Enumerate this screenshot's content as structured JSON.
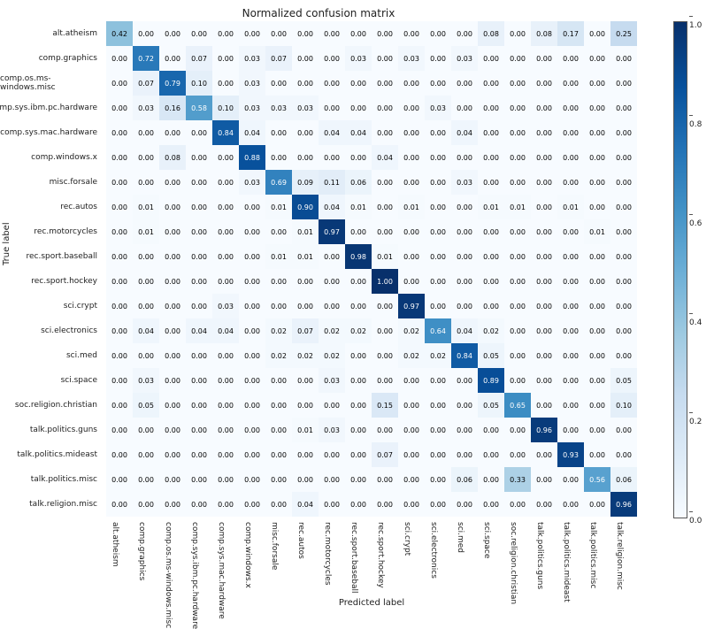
{
  "chart_data": {
    "type": "heatmap",
    "title": "Normalized confusion matrix",
    "xlabel": "Predicted label",
    "ylabel": "True label",
    "categories": [
      "alt.atheism",
      "comp.graphics",
      "comp.os.ms-windows.misc",
      "comp.sys.ibm.pc.hardware",
      "comp.sys.mac.hardware",
      "comp.windows.x",
      "misc.forsale",
      "rec.autos",
      "rec.motorcycles",
      "rec.sport.baseball",
      "rec.sport.hockey",
      "sci.crypt",
      "sci.electronics",
      "sci.med",
      "sci.space",
      "soc.religion.christian",
      "talk.politics.guns",
      "talk.politics.mideast",
      "talk.politics.misc",
      "talk.religion.misc"
    ],
    "values": [
      [
        0.42,
        0.0,
        0.0,
        0.0,
        0.0,
        0.0,
        0.0,
        0.0,
        0.0,
        0.0,
        0.0,
        0.0,
        0.0,
        0.0,
        0.08,
        0.0,
        0.08,
        0.17,
        0.0,
        0.25
      ],
      [
        0.0,
        0.72,
        0.0,
        0.07,
        0.0,
        0.03,
        0.07,
        0.0,
        0.0,
        0.03,
        0.0,
        0.03,
        0.0,
        0.03,
        0.0,
        0.0,
        0.0,
        0.0,
        0.0,
        0.0
      ],
      [
        0.0,
        0.07,
        0.79,
        0.1,
        0.0,
        0.03,
        0.0,
        0.0,
        0.0,
        0.0,
        0.0,
        0.0,
        0.0,
        0.0,
        0.0,
        0.0,
        0.0,
        0.0,
        0.0,
        0.0
      ],
      [
        0.0,
        0.03,
        0.16,
        0.58,
        0.1,
        0.03,
        0.03,
        0.03,
        0.0,
        0.0,
        0.0,
        0.0,
        0.03,
        0.0,
        0.0,
        0.0,
        0.0,
        0.0,
        0.0,
        0.0
      ],
      [
        0.0,
        0.0,
        0.0,
        0.0,
        0.84,
        0.04,
        0.0,
        0.0,
        0.04,
        0.04,
        0.0,
        0.0,
        0.0,
        0.04,
        0.0,
        0.0,
        0.0,
        0.0,
        0.0,
        0.0
      ],
      [
        0.0,
        0.0,
        0.08,
        0.0,
        0.0,
        0.88,
        0.0,
        0.0,
        0.0,
        0.0,
        0.04,
        0.0,
        0.0,
        0.0,
        0.0,
        0.0,
        0.0,
        0.0,
        0.0,
        0.0
      ],
      [
        0.0,
        0.0,
        0.0,
        0.0,
        0.0,
        0.03,
        0.69,
        0.09,
        0.11,
        0.06,
        0.0,
        0.0,
        0.0,
        0.03,
        0.0,
        0.0,
        0.0,
        0.0,
        0.0,
        0.0
      ],
      [
        0.0,
        0.01,
        0.0,
        0.0,
        0.0,
        0.0,
        0.01,
        0.9,
        0.04,
        0.01,
        0.0,
        0.01,
        0.0,
        0.0,
        0.01,
        0.01,
        0.0,
        0.01,
        0.0,
        0.0
      ],
      [
        0.0,
        0.01,
        0.0,
        0.0,
        0.0,
        0.0,
        0.0,
        0.01,
        0.97,
        0.0,
        0.0,
        0.0,
        0.0,
        0.0,
        0.0,
        0.0,
        0.0,
        0.0,
        0.01,
        0.0
      ],
      [
        0.0,
        0.0,
        0.0,
        0.0,
        0.0,
        0.0,
        0.01,
        0.01,
        0.0,
        0.98,
        0.01,
        0.0,
        0.0,
        0.0,
        0.0,
        0.0,
        0.0,
        0.0,
        0.0,
        0.0
      ],
      [
        0.0,
        0.0,
        0.0,
        0.0,
        0.0,
        0.0,
        0.0,
        0.0,
        0.0,
        0.0,
        1.0,
        0.0,
        0.0,
        0.0,
        0.0,
        0.0,
        0.0,
        0.0,
        0.0,
        0.0
      ],
      [
        0.0,
        0.0,
        0.0,
        0.0,
        0.03,
        0.0,
        0.0,
        0.0,
        0.0,
        0.0,
        0.0,
        0.97,
        0.0,
        0.0,
        0.0,
        0.0,
        0.0,
        0.0,
        0.0,
        0.0
      ],
      [
        0.0,
        0.04,
        0.0,
        0.04,
        0.04,
        0.0,
        0.02,
        0.07,
        0.02,
        0.02,
        0.0,
        0.02,
        0.64,
        0.04,
        0.02,
        0.0,
        0.0,
        0.0,
        0.0,
        0.0
      ],
      [
        0.0,
        0.0,
        0.0,
        0.0,
        0.0,
        0.0,
        0.02,
        0.02,
        0.02,
        0.0,
        0.0,
        0.02,
        0.02,
        0.84,
        0.05,
        0.0,
        0.0,
        0.0,
        0.0,
        0.0
      ],
      [
        0.0,
        0.03,
        0.0,
        0.0,
        0.0,
        0.0,
        0.0,
        0.0,
        0.03,
        0.0,
        0.0,
        0.0,
        0.0,
        0.0,
        0.89,
        0.0,
        0.0,
        0.0,
        0.0,
        0.05
      ],
      [
        0.0,
        0.05,
        0.0,
        0.0,
        0.0,
        0.0,
        0.0,
        0.0,
        0.0,
        0.0,
        0.15,
        0.0,
        0.0,
        0.0,
        0.05,
        0.65,
        0.0,
        0.0,
        0.0,
        0.1
      ],
      [
        0.0,
        0.0,
        0.0,
        0.0,
        0.0,
        0.0,
        0.0,
        0.01,
        0.03,
        0.0,
        0.0,
        0.0,
        0.0,
        0.0,
        0.0,
        0.0,
        0.96,
        0.0,
        0.0,
        0.0
      ],
      [
        0.0,
        0.0,
        0.0,
        0.0,
        0.0,
        0.0,
        0.0,
        0.0,
        0.0,
        0.0,
        0.07,
        0.0,
        0.0,
        0.0,
        0.0,
        0.0,
        0.0,
        0.93,
        0.0,
        0.0
      ],
      [
        0.0,
        0.0,
        0.0,
        0.0,
        0.0,
        0.0,
        0.0,
        0.0,
        0.0,
        0.0,
        0.0,
        0.0,
        0.0,
        0.06,
        0.0,
        0.33,
        0.0,
        0.0,
        0.56,
        0.06
      ],
      [
        0.0,
        0.0,
        0.0,
        0.0,
        0.0,
        0.0,
        0.0,
        0.04,
        0.0,
        0.0,
        0.0,
        0.0,
        0.0,
        0.0,
        0.0,
        0.0,
        0.0,
        0.0,
        0.0,
        0.96
      ]
    ],
    "colorbar_ticks": [
      "0.0",
      "0.2",
      "0.4",
      "0.6",
      "0.8",
      "1.0"
    ],
    "vmin": 0.0,
    "vmax": 1.0
  }
}
